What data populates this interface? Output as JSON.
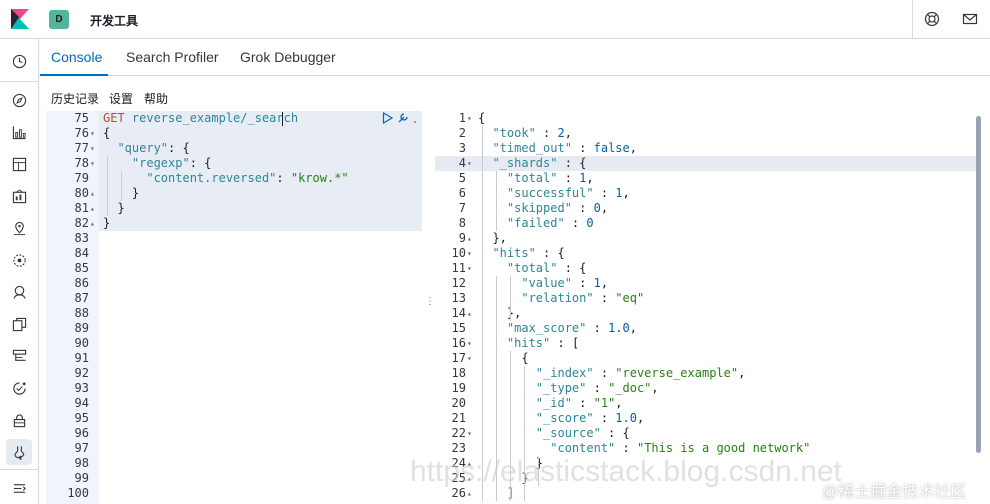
{
  "header": {
    "space_initial": "D",
    "app_title": "开发工具",
    "space_color": "#54b399"
  },
  "tabs": [
    {
      "label": "Console",
      "active": true
    },
    {
      "label": "Search Profiler",
      "active": false
    },
    {
      "label": "Grok Debugger",
      "active": false
    }
  ],
  "toolbar": {
    "history": "历史记录",
    "settings": "设置",
    "help": "帮助"
  },
  "left_nav_icons": [
    "clock-icon",
    "compass-icon",
    "visualize-icon",
    "dashboard-icon",
    "canvas-icon",
    "maps-icon",
    "ml-icon",
    "graph-icon",
    "logs-icon",
    "infra-icon",
    "apm-icon",
    "uptime-icon",
    "siem-icon",
    "devtools-icon",
    "collapse-icon"
  ],
  "editor": {
    "lines": [
      {
        "n": "75",
        "fold": "",
        "code": [
          {
            "t": "GET ",
            "c": "m"
          },
          {
            "t": "reverse_example/_search",
            "c": "k"
          }
        ]
      },
      {
        "n": "76",
        "fold": "▾",
        "code": [
          {
            "t": "{",
            "c": ""
          }
        ]
      },
      {
        "n": "77",
        "fold": "▾",
        "code": [
          {
            "t": "  ",
            "c": ""
          },
          {
            "t": "\"query\"",
            "c": "k"
          },
          {
            "t": ": {",
            "c": ""
          }
        ]
      },
      {
        "n": "78",
        "fold": "▾",
        "code": [
          {
            "t": "    ",
            "c": ""
          },
          {
            "t": "\"regexp\"",
            "c": "k"
          },
          {
            "t": ": {",
            "c": ""
          }
        ]
      },
      {
        "n": "79",
        "fold": "",
        "code": [
          {
            "t": "      ",
            "c": ""
          },
          {
            "t": "\"content.reversed\"",
            "c": "k"
          },
          {
            "t": ": ",
            "c": ""
          },
          {
            "t": "\"krow.*\"",
            "c": "s"
          }
        ]
      },
      {
        "n": "80",
        "fold": "▴",
        "code": [
          {
            "t": "    }",
            "c": ""
          }
        ]
      },
      {
        "n": "81",
        "fold": "▴",
        "code": [
          {
            "t": "  }",
            "c": ""
          }
        ]
      },
      {
        "n": "82",
        "fold": "▴",
        "code": [
          {
            "t": "}",
            "c": ""
          }
        ]
      },
      {
        "n": "83",
        "fold": "",
        "code": []
      },
      {
        "n": "84",
        "fold": "",
        "code": []
      },
      {
        "n": "85",
        "fold": "",
        "code": []
      },
      {
        "n": "86",
        "fold": "",
        "code": []
      },
      {
        "n": "87",
        "fold": "",
        "code": []
      },
      {
        "n": "88",
        "fold": "",
        "code": []
      },
      {
        "n": "89",
        "fold": "",
        "code": []
      },
      {
        "n": "90",
        "fold": "",
        "code": []
      },
      {
        "n": "91",
        "fold": "",
        "code": []
      },
      {
        "n": "92",
        "fold": "",
        "code": []
      },
      {
        "n": "93",
        "fold": "",
        "code": []
      },
      {
        "n": "94",
        "fold": "",
        "code": []
      },
      {
        "n": "95",
        "fold": "",
        "code": []
      },
      {
        "n": "96",
        "fold": "",
        "code": []
      },
      {
        "n": "97",
        "fold": "",
        "code": []
      },
      {
        "n": "98",
        "fold": "",
        "code": []
      },
      {
        "n": "99",
        "fold": "",
        "code": []
      },
      {
        "n": "100",
        "fold": "",
        "code": []
      }
    ]
  },
  "output": {
    "lines": [
      {
        "n": "1",
        "fold": "▾",
        "code": [
          {
            "t": "{",
            "c": ""
          }
        ]
      },
      {
        "n": "2",
        "fold": "",
        "code": [
          {
            "t": "  ",
            "c": ""
          },
          {
            "t": "\"took\"",
            "c": "k"
          },
          {
            "t": " : ",
            "c": ""
          },
          {
            "t": "2",
            "c": "n"
          },
          {
            "t": ",",
            "c": ""
          }
        ]
      },
      {
        "n": "3",
        "fold": "",
        "code": [
          {
            "t": "  ",
            "c": ""
          },
          {
            "t": "\"timed_out\"",
            "c": "k"
          },
          {
            "t": " : ",
            "c": ""
          },
          {
            "t": "false",
            "c": "n"
          },
          {
            "t": ",",
            "c": ""
          }
        ]
      },
      {
        "n": "4",
        "fold": "▾",
        "code": [
          {
            "t": "  ",
            "c": ""
          },
          {
            "t": "\"_shards\"",
            "c": "k"
          },
          {
            "t": " : {",
            "c": ""
          }
        ]
      },
      {
        "n": "5",
        "fold": "",
        "code": [
          {
            "t": "    ",
            "c": ""
          },
          {
            "t": "\"total\"",
            "c": "k"
          },
          {
            "t": " : ",
            "c": ""
          },
          {
            "t": "1",
            "c": "n"
          },
          {
            "t": ",",
            "c": ""
          }
        ]
      },
      {
        "n": "6",
        "fold": "",
        "code": [
          {
            "t": "    ",
            "c": ""
          },
          {
            "t": "\"successful\"",
            "c": "k"
          },
          {
            "t": " : ",
            "c": ""
          },
          {
            "t": "1",
            "c": "n"
          },
          {
            "t": ",",
            "c": ""
          }
        ]
      },
      {
        "n": "7",
        "fold": "",
        "code": [
          {
            "t": "    ",
            "c": ""
          },
          {
            "t": "\"skipped\"",
            "c": "k"
          },
          {
            "t": " : ",
            "c": ""
          },
          {
            "t": "0",
            "c": "n"
          },
          {
            "t": ",",
            "c": ""
          }
        ]
      },
      {
        "n": "8",
        "fold": "",
        "code": [
          {
            "t": "    ",
            "c": ""
          },
          {
            "t": "\"failed\"",
            "c": "k"
          },
          {
            "t": " : ",
            "c": ""
          },
          {
            "t": "0",
            "c": "n"
          }
        ]
      },
      {
        "n": "9",
        "fold": "▴",
        "code": [
          {
            "t": "  },",
            "c": ""
          }
        ]
      },
      {
        "n": "10",
        "fold": "▾",
        "code": [
          {
            "t": "  ",
            "c": ""
          },
          {
            "t": "\"hits\"",
            "c": "k"
          },
          {
            "t": " : {",
            "c": ""
          }
        ]
      },
      {
        "n": "11",
        "fold": "▾",
        "code": [
          {
            "t": "    ",
            "c": ""
          },
          {
            "t": "\"total\"",
            "c": "k"
          },
          {
            "t": " : {",
            "c": ""
          }
        ]
      },
      {
        "n": "12",
        "fold": "",
        "code": [
          {
            "t": "      ",
            "c": ""
          },
          {
            "t": "\"value\"",
            "c": "k"
          },
          {
            "t": " : ",
            "c": ""
          },
          {
            "t": "1",
            "c": "n"
          },
          {
            "t": ",",
            "c": ""
          }
        ]
      },
      {
        "n": "13",
        "fold": "",
        "code": [
          {
            "t": "      ",
            "c": ""
          },
          {
            "t": "\"relation\"",
            "c": "k"
          },
          {
            "t": " : ",
            "c": ""
          },
          {
            "t": "\"eq\"",
            "c": "s"
          }
        ]
      },
      {
        "n": "14",
        "fold": "▴",
        "code": [
          {
            "t": "    },",
            "c": ""
          }
        ]
      },
      {
        "n": "15",
        "fold": "",
        "code": [
          {
            "t": "    ",
            "c": ""
          },
          {
            "t": "\"max_score\"",
            "c": "k"
          },
          {
            "t": " : ",
            "c": ""
          },
          {
            "t": "1.0",
            "c": "n"
          },
          {
            "t": ",",
            "c": ""
          }
        ]
      },
      {
        "n": "16",
        "fold": "▾",
        "code": [
          {
            "t": "    ",
            "c": ""
          },
          {
            "t": "\"hits\"",
            "c": "k"
          },
          {
            "t": " : [",
            "c": ""
          }
        ]
      },
      {
        "n": "17",
        "fold": "▾",
        "code": [
          {
            "t": "      {",
            "c": ""
          }
        ]
      },
      {
        "n": "18",
        "fold": "",
        "code": [
          {
            "t": "        ",
            "c": ""
          },
          {
            "t": "\"_index\"",
            "c": "k"
          },
          {
            "t": " : ",
            "c": ""
          },
          {
            "t": "\"reverse_example\"",
            "c": "s"
          },
          {
            "t": ",",
            "c": ""
          }
        ]
      },
      {
        "n": "19",
        "fold": "",
        "code": [
          {
            "t": "        ",
            "c": ""
          },
          {
            "t": "\"_type\"",
            "c": "k"
          },
          {
            "t": " : ",
            "c": ""
          },
          {
            "t": "\"_doc\"",
            "c": "s"
          },
          {
            "t": ",",
            "c": ""
          }
        ]
      },
      {
        "n": "20",
        "fold": "",
        "code": [
          {
            "t": "        ",
            "c": ""
          },
          {
            "t": "\"_id\"",
            "c": "k"
          },
          {
            "t": " : ",
            "c": ""
          },
          {
            "t": "\"1\"",
            "c": "s"
          },
          {
            "t": ",",
            "c": ""
          }
        ]
      },
      {
        "n": "21",
        "fold": "",
        "code": [
          {
            "t": "        ",
            "c": ""
          },
          {
            "t": "\"_score\"",
            "c": "k"
          },
          {
            "t": " : ",
            "c": ""
          },
          {
            "t": "1.0",
            "c": "n"
          },
          {
            "t": ",",
            "c": ""
          }
        ]
      },
      {
        "n": "22",
        "fold": "▾",
        "code": [
          {
            "t": "        ",
            "c": ""
          },
          {
            "t": "\"_source\"",
            "c": "k"
          },
          {
            "t": " : {",
            "c": ""
          }
        ]
      },
      {
        "n": "23",
        "fold": "",
        "code": [
          {
            "t": "          ",
            "c": ""
          },
          {
            "t": "\"content\"",
            "c": "k"
          },
          {
            "t": " : ",
            "c": ""
          },
          {
            "t": "\"This is a good network\"",
            "c": "s"
          }
        ]
      },
      {
        "n": "24",
        "fold": "▴",
        "code": [
          {
            "t": "        }",
            "c": ""
          }
        ]
      },
      {
        "n": "25",
        "fold": "▴",
        "code": [
          {
            "t": "      }",
            "c": ""
          }
        ]
      },
      {
        "n": "26",
        "fold": "▴",
        "code": [
          {
            "t": "    ]",
            "c": ""
          }
        ]
      }
    ]
  },
  "watermark": {
    "main": "https://elasticstack.blog.csdn.net",
    "corner": "@稀土掘金技术社区"
  }
}
